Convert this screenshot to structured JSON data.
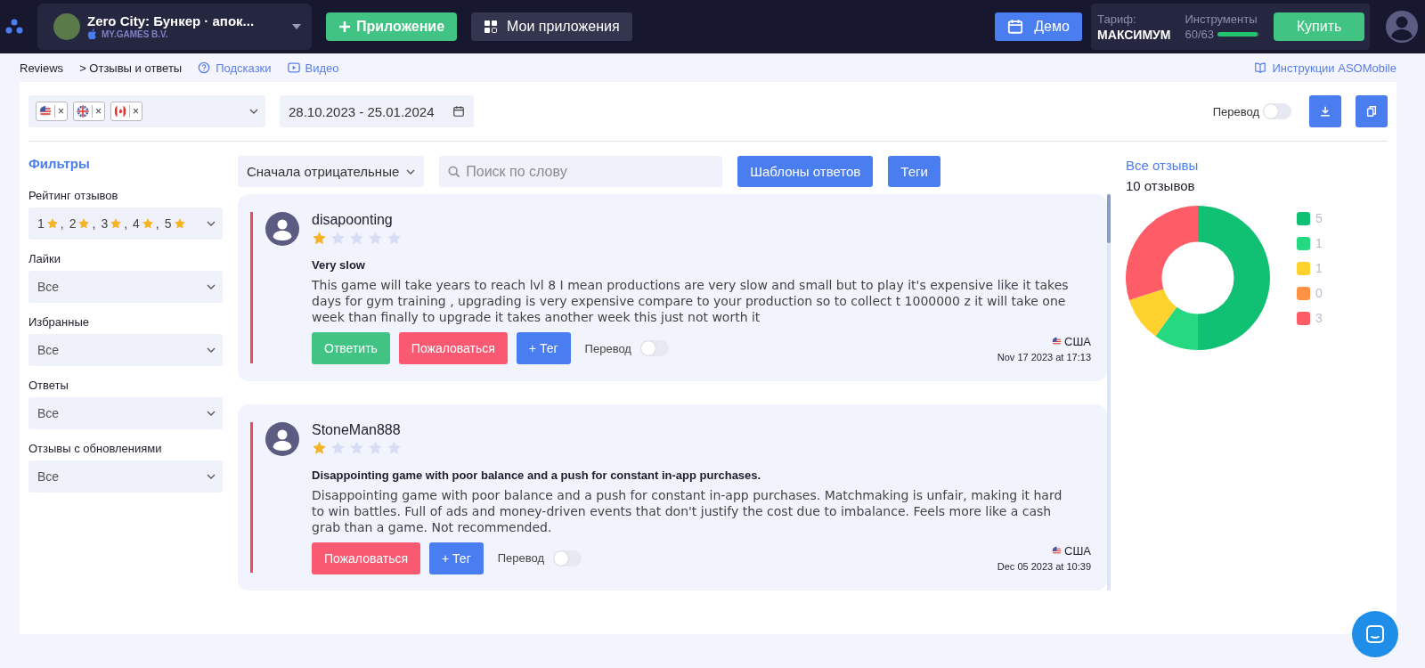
{
  "topbar": {
    "app": {
      "title": "Zero City: Бункер · апок...",
      "publisher": "MY.GAMES B.V."
    },
    "add_button": "Приложение",
    "my_apps_button": "Мои приложения",
    "demo_button": "Демо",
    "tariff": {
      "label": "Тариф:",
      "plan": "МАКСИМУМ",
      "tools_label": "Инструменты",
      "tools_count": "60/63",
      "level": 0.95
    },
    "buy_button": "Купить"
  },
  "breadcrumb": {
    "root": "Reviews",
    "current": "> Отзывы и ответы",
    "hints_link": "Подсказки",
    "video_link": "Видео",
    "instructions_link": "Инструкции ASOMobile"
  },
  "toolbar": {
    "countries": [
      {
        "kind": "us",
        "remove": "×"
      },
      {
        "kind": "gb",
        "remove": "×"
      },
      {
        "kind": "ca",
        "remove": "×"
      }
    ],
    "date_range": "28.10.2023 - 25.01.2024",
    "translate_label": "Перевод",
    "translate_on": false
  },
  "filters": {
    "title": "Фильтры",
    "rating": {
      "label": "Рейтинг отзывов",
      "values": [
        "1",
        "2",
        "3",
        "4",
        "5"
      ],
      "separator": ","
    },
    "selects": [
      {
        "label": "Лайки",
        "value": "Все"
      },
      {
        "label": "Избранные",
        "value": "Все"
      },
      {
        "label": "Ответы",
        "value": "Все"
      },
      {
        "label": "Отзывы с обновлениями",
        "value": "Все"
      }
    ]
  },
  "list_controls": {
    "sort": "Сначала отрицательные",
    "search": {
      "placeholder": "Поиск по слову"
    },
    "templates_button": "Шаблоны ответов",
    "tags_button": "Теги"
  },
  "reviews": [
    {
      "author": "disapoonting",
      "stars": 1,
      "title": "Very slow",
      "text": "This game will take years to reach lvl 8 I mean productions are very slow and small but to play it's expensive like it takes days for gym training , upgrading is very expensive compare to your production so to collect t 1000000 z it will take one week than finally to upgrade it takes another week this just not worth it",
      "actions": [
        {
          "kind": "reply",
          "label": "Ответить"
        },
        {
          "kind": "complain",
          "label": "Пожаловаться"
        },
        {
          "kind": "tag",
          "label": "+ Тег"
        }
      ],
      "translate_label": "Перевод",
      "translate_on": false,
      "country": "США",
      "date": "Nov 17 2023 at 17:13"
    },
    {
      "author": "StoneMan888",
      "stars": 1,
      "title": "Disappointing game with poor balance and a push for constant in-app purchases.",
      "text": "Disappointing game with poor balance and a push for constant in-app purchases. Matchmaking is unfair, making it hard to win battles. Full of ads and money-driven events that don't justify the cost due to imbalance. Feels more like a cash grab than a game. Not recommended.",
      "actions": [
        {
          "kind": "complain",
          "label": "Пожаловаться"
        },
        {
          "kind": "tag",
          "label": "+ Тег"
        }
      ],
      "translate_label": "Перевод",
      "translate_on": false,
      "country": "США",
      "date": "Dec 05 2023 at 10:39"
    }
  ],
  "summary": {
    "title": "Все отзывы",
    "count": "10 отзывов",
    "chart_data": {
      "type": "donut",
      "legend": "right",
      "categories": [
        "5",
        "1",
        "1",
        "0",
        "3"
      ],
      "values": [
        5,
        1,
        1,
        0,
        3
      ],
      "colors": [
        "#10c073",
        "#26d87f",
        "#fdd22d",
        "#ff9243",
        "#fe5c67"
      ]
    }
  }
}
